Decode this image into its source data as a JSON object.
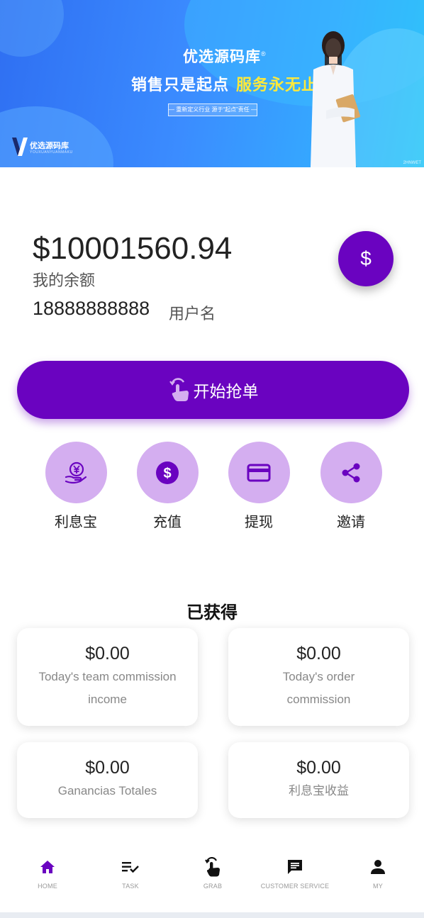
{
  "banner": {
    "brand_title": "优选源码库",
    "brand_mark": "®",
    "slogan_white": "销售只是起点",
    "slogan_yellow": "服务永无止境",
    "subline": "— 重新定义行业 源于“起点”责任 —",
    "logo_text": "优选源码库",
    "logo_sub": "YOUXUANYUANMAKU",
    "watermark": "2HNWET"
  },
  "account": {
    "balance": "$10001560.94",
    "balance_label": "我的余额",
    "phone": "18888888888",
    "username_label": "用户名",
    "fab_symbol": "$"
  },
  "grab": {
    "label": "开始抢单",
    "icon": "hand-tap-icon"
  },
  "actions": [
    {
      "label": "利息宝",
      "icon": "yuan-hand-icon"
    },
    {
      "label": "充值",
      "icon": "dollar-circle-icon"
    },
    {
      "label": "提现",
      "icon": "credit-card-icon"
    },
    {
      "label": "邀请",
      "icon": "share-icon"
    }
  ],
  "earnings": {
    "title": "已获得",
    "cards": [
      {
        "value": "$0.00",
        "label": "Today's team commission income"
      },
      {
        "value": "$0.00",
        "label": "Today's order commission"
      },
      {
        "value": "$0.00",
        "label": "Ganancias Totales"
      },
      {
        "value": "$0.00",
        "label": "利息宝收益"
      }
    ]
  },
  "nav": [
    {
      "label": "HOME",
      "icon": "home-icon",
      "active": true
    },
    {
      "label": "TASK",
      "icon": "task-list-icon",
      "active": false
    },
    {
      "label": "GRAB",
      "icon": "grab-hand-icon",
      "active": false
    },
    {
      "label": "CUSTOMER SERVICE",
      "icon": "chat-icon",
      "active": false
    },
    {
      "label": "MY",
      "icon": "person-icon",
      "active": false
    }
  ],
  "colors": {
    "primary": "#6a03c0",
    "action_circle": "#d4aef0",
    "banner_blue": "#2f6ff2",
    "slogan_yellow": "#ffe93a"
  }
}
